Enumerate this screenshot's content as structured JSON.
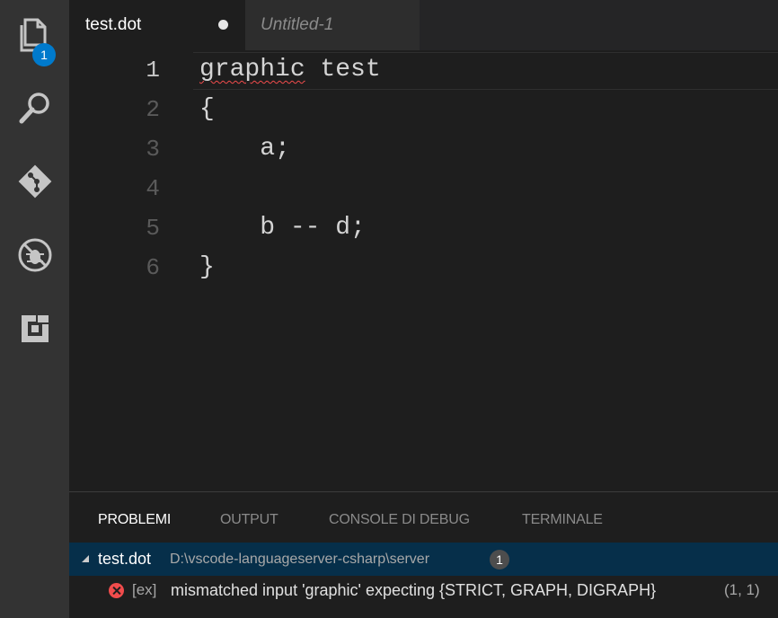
{
  "activity_bar": {
    "items": [
      {
        "icon": "files-icon"
      },
      {
        "icon": "search-icon"
      },
      {
        "icon": "git-icon"
      },
      {
        "icon": "debug-icon"
      },
      {
        "icon": "extensions-icon"
      }
    ],
    "explorer_badge": "1"
  },
  "tabs": [
    {
      "label": "test.dot",
      "active": true,
      "dirty": true
    },
    {
      "label": "Untitled-1",
      "active": false
    }
  ],
  "editor": {
    "lines": [
      {
        "n": "1",
        "text": "graphic test",
        "error_word": "graphic",
        "rest": " test"
      },
      {
        "n": "2",
        "text": "{"
      },
      {
        "n": "3",
        "text": "    a;"
      },
      {
        "n": "4",
        "text": ""
      },
      {
        "n": "5",
        "text": "    b -- d;"
      },
      {
        "n": "6",
        "text": "}"
      }
    ]
  },
  "panel": {
    "tabs": [
      "PROBLEMI",
      "OUTPUT",
      "CONSOLE DI DEBUG",
      "TERMINALE"
    ],
    "active_tab": "PROBLEMI",
    "file": {
      "name": "test.dot",
      "path": "D:\\vscode-languageserver-csharp\\server",
      "count": "1"
    },
    "problem": {
      "source": "[ex]",
      "message": "mismatched input 'graphic' expecting {STRICT, GRAPH, DIGRAPH}",
      "location": "(1, 1)"
    }
  },
  "colors": {
    "accent": "#007acc",
    "error": "#f14c4c",
    "selection": "#062f4a"
  }
}
